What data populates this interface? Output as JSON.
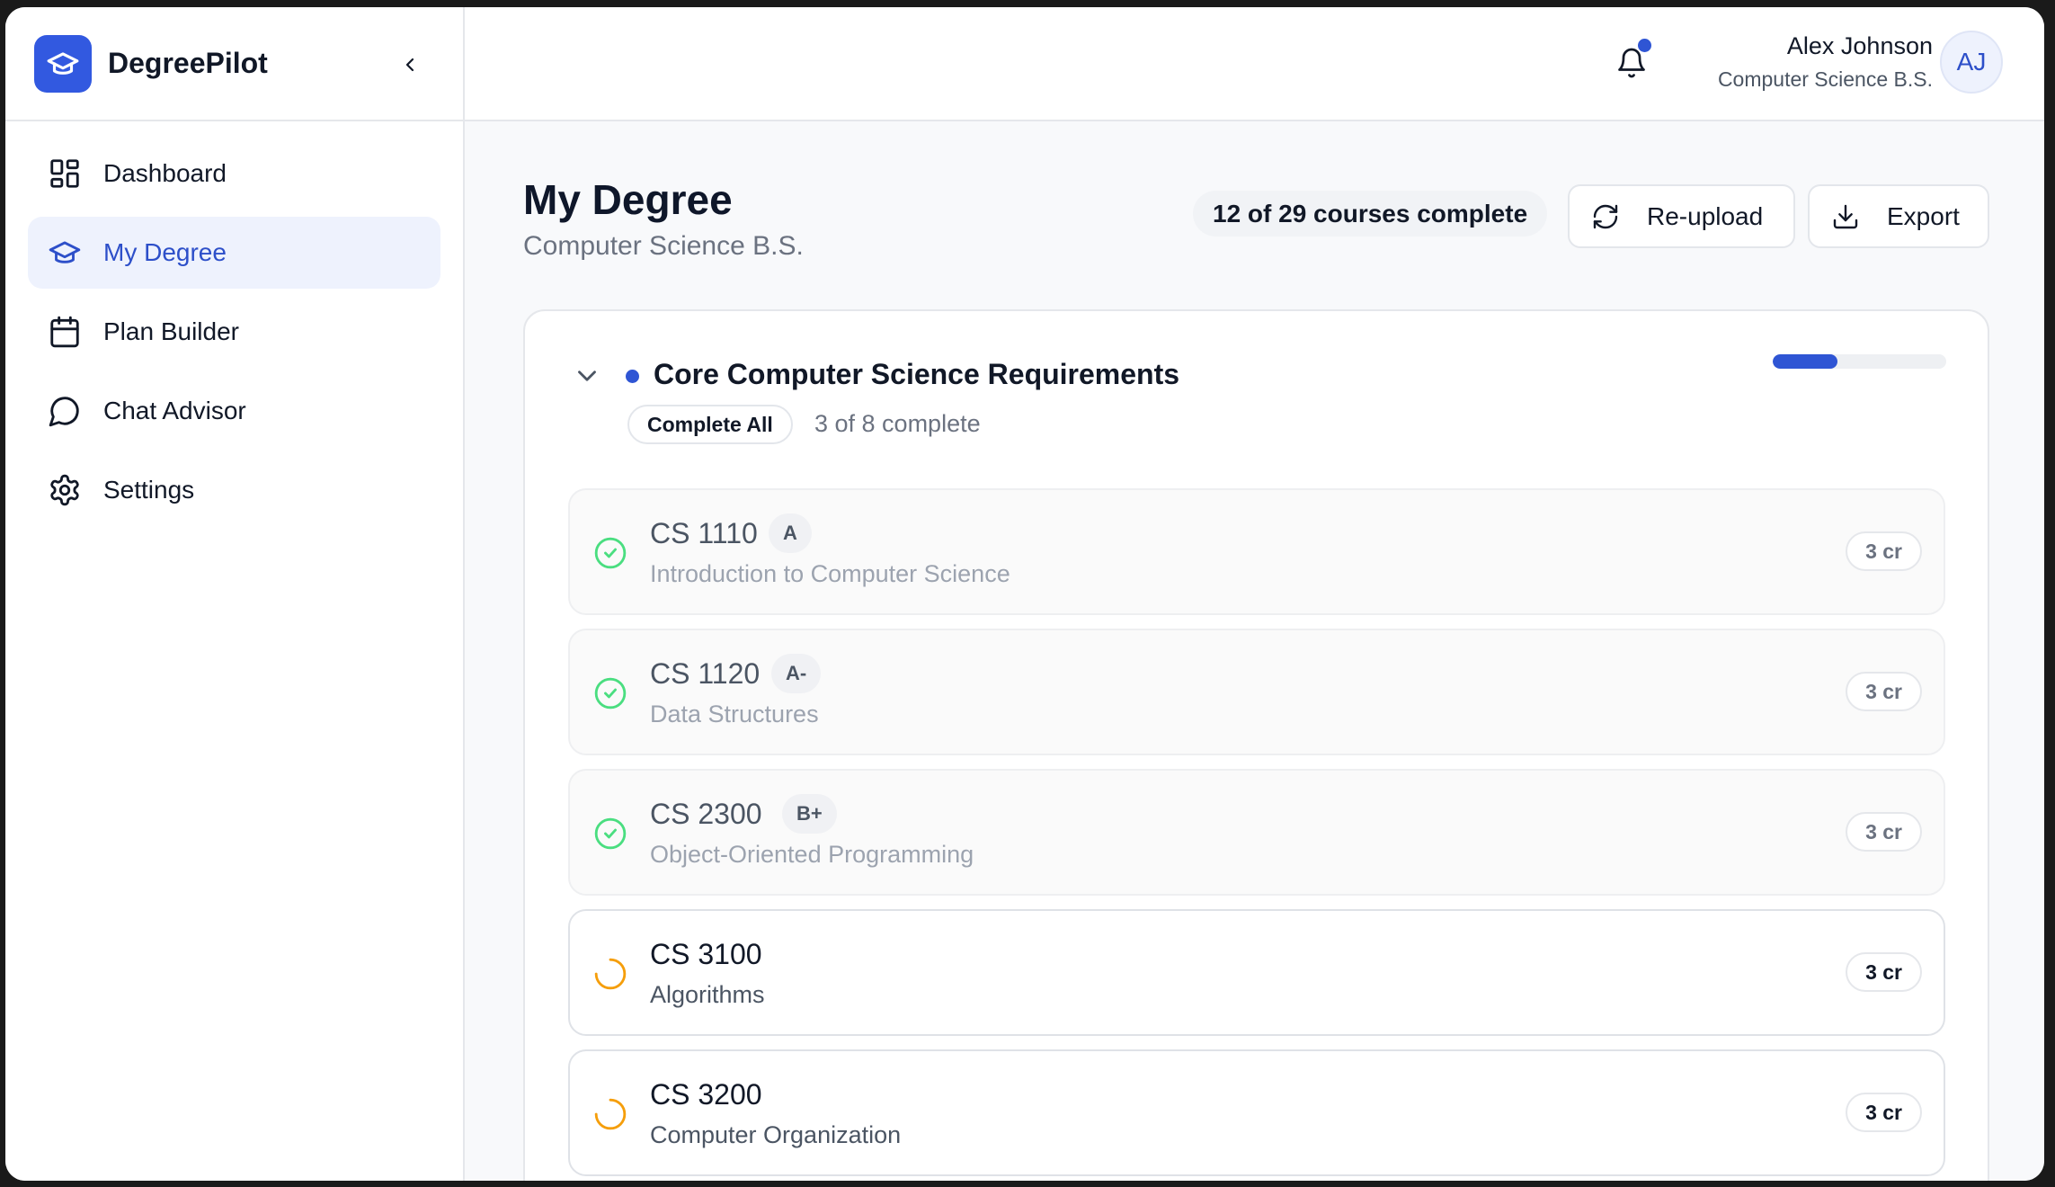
{
  "app": {
    "name": "DegreePilot"
  },
  "nav": {
    "items": [
      {
        "label": "Dashboard",
        "icon": "dashboard-icon",
        "active": false
      },
      {
        "label": "My Degree",
        "icon": "graduation-cap-icon",
        "active": true
      },
      {
        "label": "Plan Builder",
        "icon": "calendar-icon",
        "active": false
      },
      {
        "label": "Chat Advisor",
        "icon": "chat-bubble-icon",
        "active": false
      },
      {
        "label": "Settings",
        "icon": "gear-icon",
        "active": false
      }
    ]
  },
  "user": {
    "name": "Alex Johnson",
    "program": "Computer Science B.S.",
    "initials": "AJ",
    "has_notifications": true
  },
  "page": {
    "title": "My Degree",
    "subtitle": "Computer Science B.S.",
    "progress_label": "12 of 29 courses complete",
    "reupload_label": "Re-upload",
    "export_label": "Export"
  },
  "requirement": {
    "title": "Core Computer Science Requirements",
    "complete_all_label": "Complete All",
    "count_label": "3 of 8 complete",
    "completed": 3,
    "total": 8,
    "courses": [
      {
        "code": "CS 1110",
        "grade": "A",
        "name": "Introduction to Computer Science",
        "credits": "3 cr",
        "status": "complete"
      },
      {
        "code": "CS 1120",
        "grade": "A-",
        "name": "Data Structures",
        "credits": "3 cr",
        "status": "complete"
      },
      {
        "code": "CS 2300",
        "grade": "B+",
        "name": "Object-Oriented Programming",
        "credits": "3 cr",
        "status": "complete"
      },
      {
        "code": "CS 3100",
        "grade": "",
        "name": "Algorithms",
        "credits": "3 cr",
        "status": "in-progress"
      },
      {
        "code": "CS 3200",
        "grade": "",
        "name": "Computer Organization",
        "credits": "3 cr",
        "status": "in-progress"
      }
    ]
  },
  "colors": {
    "accent": "#2f55d4",
    "complete": "#4ade80",
    "in_progress": "#f59e0b"
  }
}
